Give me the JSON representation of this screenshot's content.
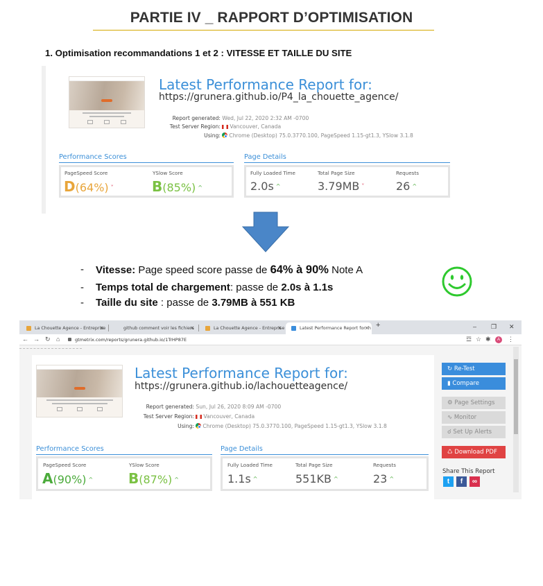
{
  "doc": {
    "title": "PARTIE IV _ RAPPORT D’OPTIMISATION",
    "subtitle": "1. Optimisation recommandations 1 et 2 : VITESSE ET TAILLE DU SITE"
  },
  "report_before": {
    "heading": "Latest Performance Report for:",
    "url": "https://grunera.github.io/P4_la_chouette_agence/",
    "generated_label": "Report generated:",
    "generated_value": "Wed, Jul 22, 2020 2:32 AM -0700",
    "region_label": "Test Server Region:",
    "region_value": "Vancouver, Canada",
    "using_label": "Using:",
    "using_value": "Chrome (Desktop) 75.0.3770.100, PageSpeed 1.15-gt1.3, YSlow 3.1.8",
    "perf_label": "Performance Scores",
    "details_label": "Page Details",
    "pagespeed_label": "PageSpeed Score",
    "pagespeed_grade": "D",
    "pagespeed_pct": "(64%)",
    "yslow_label": "YSlow Score",
    "yslow_grade": "B",
    "yslow_pct": "(85%)",
    "load_label": "Fully Loaded Time",
    "load_value": "2.0s",
    "size_label": "Total Page Size",
    "size_value": "3.79MB",
    "requests_label": "Requests",
    "requests_value": "26",
    "caret_up": "^",
    "caret_down": "˅"
  },
  "bullets": {
    "b1_bold": "Vitesse:",
    "b1_text": " Page speed score passe de ",
    "b1_value": "64% à 90%",
    "b1_note": "  Note A",
    "b2_bold": "Temps total de chargement",
    "b2_text": ": passe de ",
    "b2_value": "2.0s à 1.1s",
    "b3_bold": "Taille du site",
    "b3_text": " : passe de ",
    "b3_value": "3.79MB à 551 KB",
    "dash": "-"
  },
  "browser": {
    "tabs": [
      "La Chouette Agence - Entreprise",
      "github comment voir les fichiers",
      "La Chouette Agence - Entreprise",
      "Latest Performance Report for: h"
    ],
    "tab_close": "×",
    "new_tab": "+",
    "url": "gtmetrix.com/reports/grunera.github.io/1TrHP87E",
    "avatar": "A",
    "win_min": "–",
    "win_max": "❐",
    "win_close": "✕"
  },
  "report_after": {
    "heading": "Latest Performance Report for:",
    "url": "https://grunera.github.io/lachouetteagence/",
    "generated_label": "Report generated:",
    "generated_value": "Sun, Jul 26, 2020 8:09 AM -0700",
    "region_label": "Test Server Region:",
    "region_value": "Vancouver, Canada",
    "using_label": "Using:",
    "using_value": "Chrome (Desktop) 75.0.3770.100, PageSpeed 1.15-gt1.3, YSlow 3.1.8",
    "perf_label": "Performance Scores",
    "details_label": "Page Details",
    "pagespeed_label": "PageSpeed Score",
    "pagespeed_grade": "A",
    "pagespeed_pct": "(90%)",
    "yslow_label": "YSlow Score",
    "yslow_grade": "B",
    "yslow_pct": "(87%)",
    "load_label": "Fully Loaded Time",
    "load_value": "1.1s",
    "size_label": "Total Page Size",
    "size_value": "551KB",
    "requests_label": "Requests",
    "requests_value": "23",
    "caret_up": "^"
  },
  "sidebar": {
    "retest": "Re-Test",
    "compare": "Compare",
    "page_settings": "Page Settings",
    "monitor": "Monitor",
    "alerts": "Set Up Alerts",
    "download": "Download PDF",
    "share": "Share This Report"
  },
  "colors": {
    "accent_blue": "#3b8fd8",
    "grade_a": "#4bab3b",
    "grade_b": "#7ac143",
    "grade_d": "#e8a53a",
    "caret_up": "#4bab3b",
    "caret_down": "#d9304e",
    "arrow": "#4a86c8",
    "smiley": "#2ec92e"
  }
}
